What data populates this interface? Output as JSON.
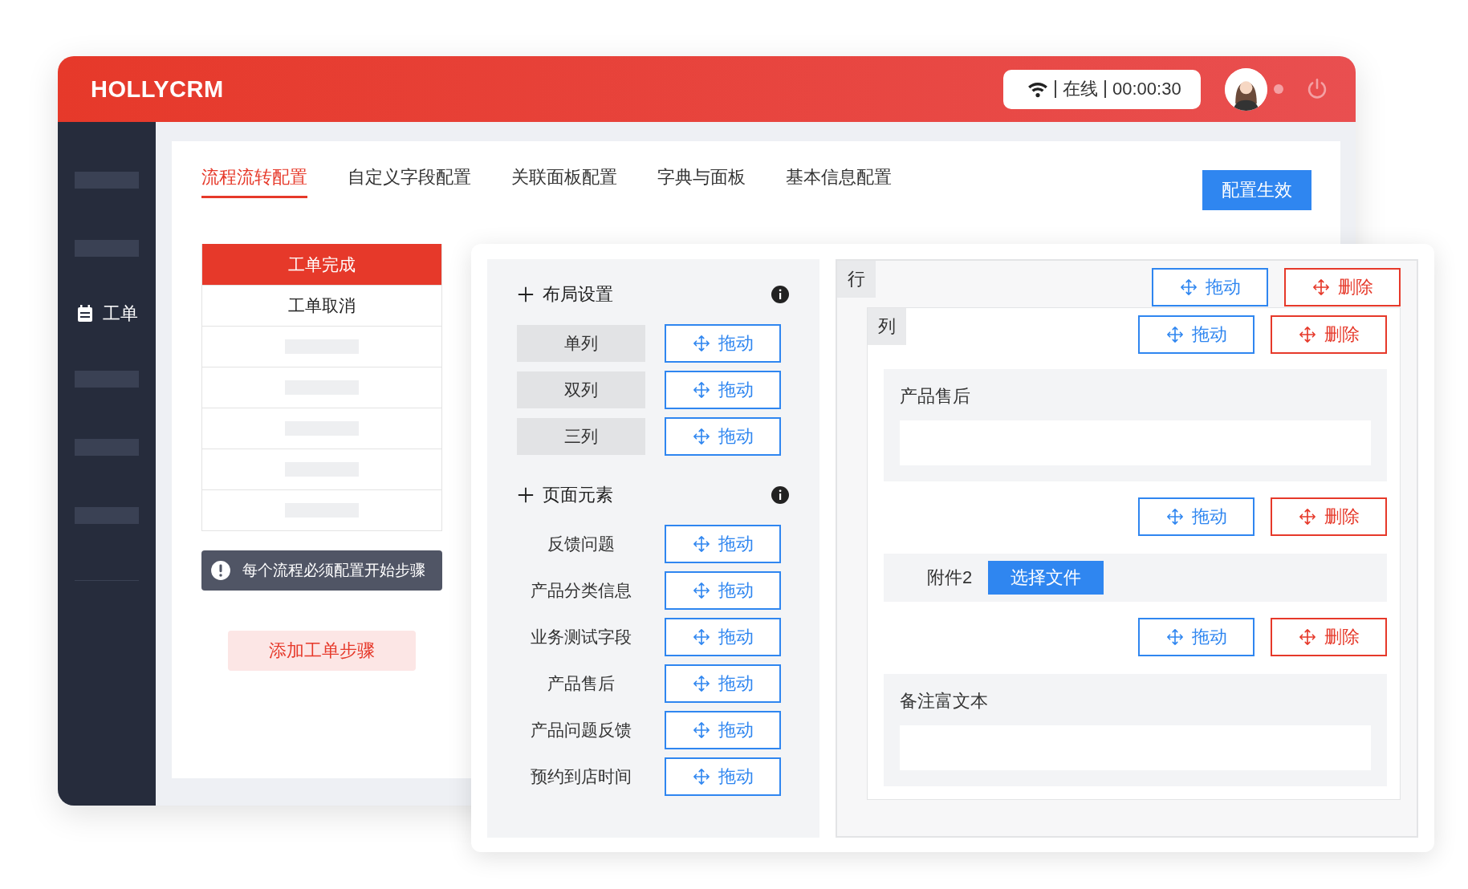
{
  "app": {
    "logo": "HOLLYCRM"
  },
  "header": {
    "status": {
      "state": "在线",
      "timer": "00:00:30"
    }
  },
  "sidebar": {
    "items": [
      {
        "kind": "placeholder"
      },
      {
        "kind": "placeholder"
      },
      {
        "kind": "item",
        "label": "工单"
      },
      {
        "kind": "placeholder"
      },
      {
        "kind": "placeholder"
      },
      {
        "kind": "placeholder"
      }
    ]
  },
  "tabs": [
    {
      "label": "流程流转配置",
      "selected": true
    },
    {
      "label": "自定义字段配置",
      "selected": false
    },
    {
      "label": "关联面板配置",
      "selected": false
    },
    {
      "label": "字典与面板",
      "selected": false
    },
    {
      "label": "基本信息配置",
      "selected": false
    }
  ],
  "apply_button": "配置生效",
  "steps": [
    {
      "kind": "step",
      "label": "工单完成",
      "selected": true
    },
    {
      "kind": "step",
      "label": "工单取消",
      "selected": false
    },
    {
      "kind": "placeholder"
    },
    {
      "kind": "placeholder"
    },
    {
      "kind": "placeholder"
    },
    {
      "kind": "placeholder"
    },
    {
      "kind": "placeholder"
    }
  ],
  "notice": "每个流程必须配置开始步骤",
  "add_step_button": "添加工单步骤",
  "palette": {
    "sections": [
      {
        "title": "布局设置",
        "items": [
          {
            "kind": "layout",
            "label": "单列",
            "drag": "拖动"
          },
          {
            "kind": "layout",
            "label": "双列",
            "drag": "拖动"
          },
          {
            "kind": "layout",
            "label": "三列",
            "drag": "拖动"
          }
        ]
      },
      {
        "title": "页面元素",
        "items": [
          {
            "kind": "field",
            "label": "反馈问题",
            "drag": "拖动"
          },
          {
            "kind": "field",
            "label": "产品分类信息",
            "drag": "拖动"
          },
          {
            "kind": "field",
            "label": "业务测试字段",
            "drag": "拖动"
          },
          {
            "kind": "field",
            "label": "产品售后",
            "drag": "拖动"
          },
          {
            "kind": "field",
            "label": "产品问题反馈",
            "drag": "拖动"
          },
          {
            "kind": "field",
            "label": "预约到店时间",
            "drag": "拖动"
          }
        ]
      }
    ]
  },
  "canvas": {
    "row": {
      "tag": "行",
      "drag": "拖动",
      "delete": "删除"
    },
    "column": {
      "tag": "列",
      "drag": "拖动",
      "delete": "删除"
    },
    "fields": [
      {
        "kind": "input",
        "label": "产品售后"
      },
      {
        "kind": "file",
        "label": "附件2",
        "button": "选择文件",
        "drag": "拖动",
        "delete": "删除"
      },
      {
        "kind": "input",
        "label": "备注富文本",
        "drag": "拖动",
        "delete": "删除"
      }
    ]
  }
}
